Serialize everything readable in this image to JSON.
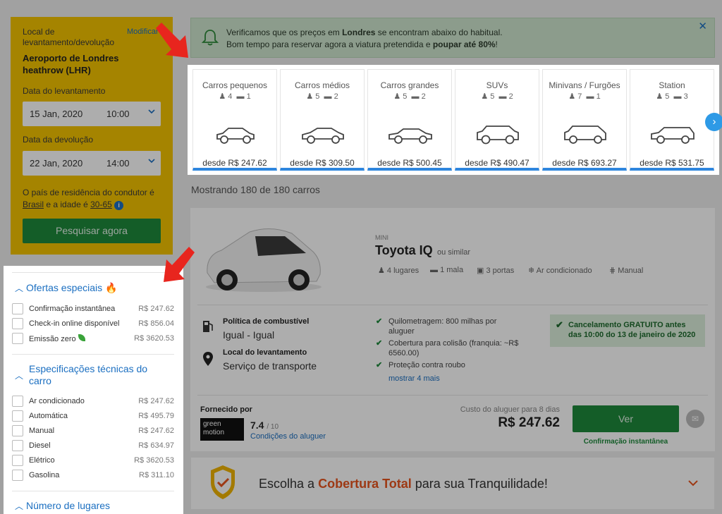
{
  "search": {
    "location_label": "Local de levantamento/devolução",
    "modify_label": "Modificar",
    "location_value": "Aeroporto de Londres heathrow (LHR)",
    "pickup_label": "Data do levantamento",
    "pickup_date": "15 Jan, 2020",
    "pickup_time": "10:00",
    "dropoff_label": "Data da devolução",
    "dropoff_date": "22 Jan, 2020",
    "dropoff_time": "14:00",
    "residence_prefix": "O país de residência do condutor é",
    "country": "Brasil",
    "age_text": "e a idade é",
    "age": "30-65",
    "button_label": "Pesquisar agora"
  },
  "alert": {
    "line1_pre": "Verificamos que os preços em",
    "line1_city": "Londres",
    "line1_post": "se encontram abaixo do habitual.",
    "line2_pre": "Bom tempo para reservar agora a viatura pretendida e",
    "line2_bold": "poupar até 80%",
    "line2_post": "!"
  },
  "categories": [
    {
      "name": "Carros pequenos",
      "seats": "4",
      "bags": "1",
      "price": "desde R$ 247.62"
    },
    {
      "name": "Carros médios",
      "seats": "5",
      "bags": "2",
      "price": "desde R$ 309.50"
    },
    {
      "name": "Carros grandes",
      "seats": "5",
      "bags": "2",
      "price": "desde R$ 500.45"
    },
    {
      "name": "SUVs",
      "seats": "5",
      "bags": "2",
      "price": "desde R$ 490.47"
    },
    {
      "name": "Minivans / Furgões",
      "seats": "7",
      "bags": "1",
      "price": "desde R$ 693.27"
    },
    {
      "name": "Station",
      "seats": "5",
      "bags": "3",
      "price": "desde R$ 531.75"
    }
  ],
  "showing_text": "Mostrando 180 de 180 carros",
  "filters": {
    "special": {
      "title": "Ofertas especiais",
      "items": [
        {
          "label": "Confirmação instantânea",
          "price": "R$ 247.62"
        },
        {
          "label": "Check-in online disponível",
          "price": "R$ 856.04"
        },
        {
          "label": "Emissão zero",
          "price": "R$ 3620.53"
        }
      ]
    },
    "specs": {
      "title": "Especificações técnicas do carro",
      "items": [
        {
          "label": "Ar condicionado",
          "price": "R$ 247.62"
        },
        {
          "label": "Automática",
          "price": "R$ 495.79"
        },
        {
          "label": "Manual",
          "price": "R$ 247.62"
        },
        {
          "label": "Diesel",
          "price": "R$ 634.97"
        },
        {
          "label": "Elétrico",
          "price": "R$ 3620.53"
        },
        {
          "label": "Gasolina",
          "price": "R$ 311.10"
        }
      ]
    },
    "seats_title": "Número de lugares"
  },
  "result": {
    "class": "MINI",
    "model": "Toyota IQ",
    "similar": "ou similar",
    "features": [
      "4 lugares",
      "1 mala",
      "3 portas",
      "Ar condicionado",
      "Manual"
    ],
    "fuel_policy_title": "Política de combustível",
    "fuel_policy_value": "Igual - Igual",
    "pickup_title": "Local do levantamento",
    "pickup_value": "Serviço de transporte",
    "checks": [
      "Quilometragem: 800 milhas por aluguer",
      "Cobertura para colisão (franquia: ~R$ 6560.00)",
      "Proteção contra roubo"
    ],
    "more_link": "mostrar 4 mais",
    "cancel_text": "Cancelamento GRATUITO antes das 10:00 do 13 de janeiro de 2020",
    "supplier_label": "Fornecido por",
    "supplier_logo": "green motion",
    "rating": "7.4",
    "rating_max": "/ 10",
    "conditions_link": "Condições do aluguer",
    "cost_label": "Custo do aluguer para 8 dias",
    "price": "R$ 247.62",
    "button_label": "Ver",
    "instant_confirm": "Confirmação instantânea"
  },
  "banner": {
    "pre": "Escolha a",
    "bold": "Cobertura Total",
    "post": "para sua Tranquilidade!"
  },
  "colors": {
    "accent": "#2e86de",
    "green": "#1e8a3c",
    "yellow": "#f4c300",
    "arrow": "#e8251e"
  }
}
